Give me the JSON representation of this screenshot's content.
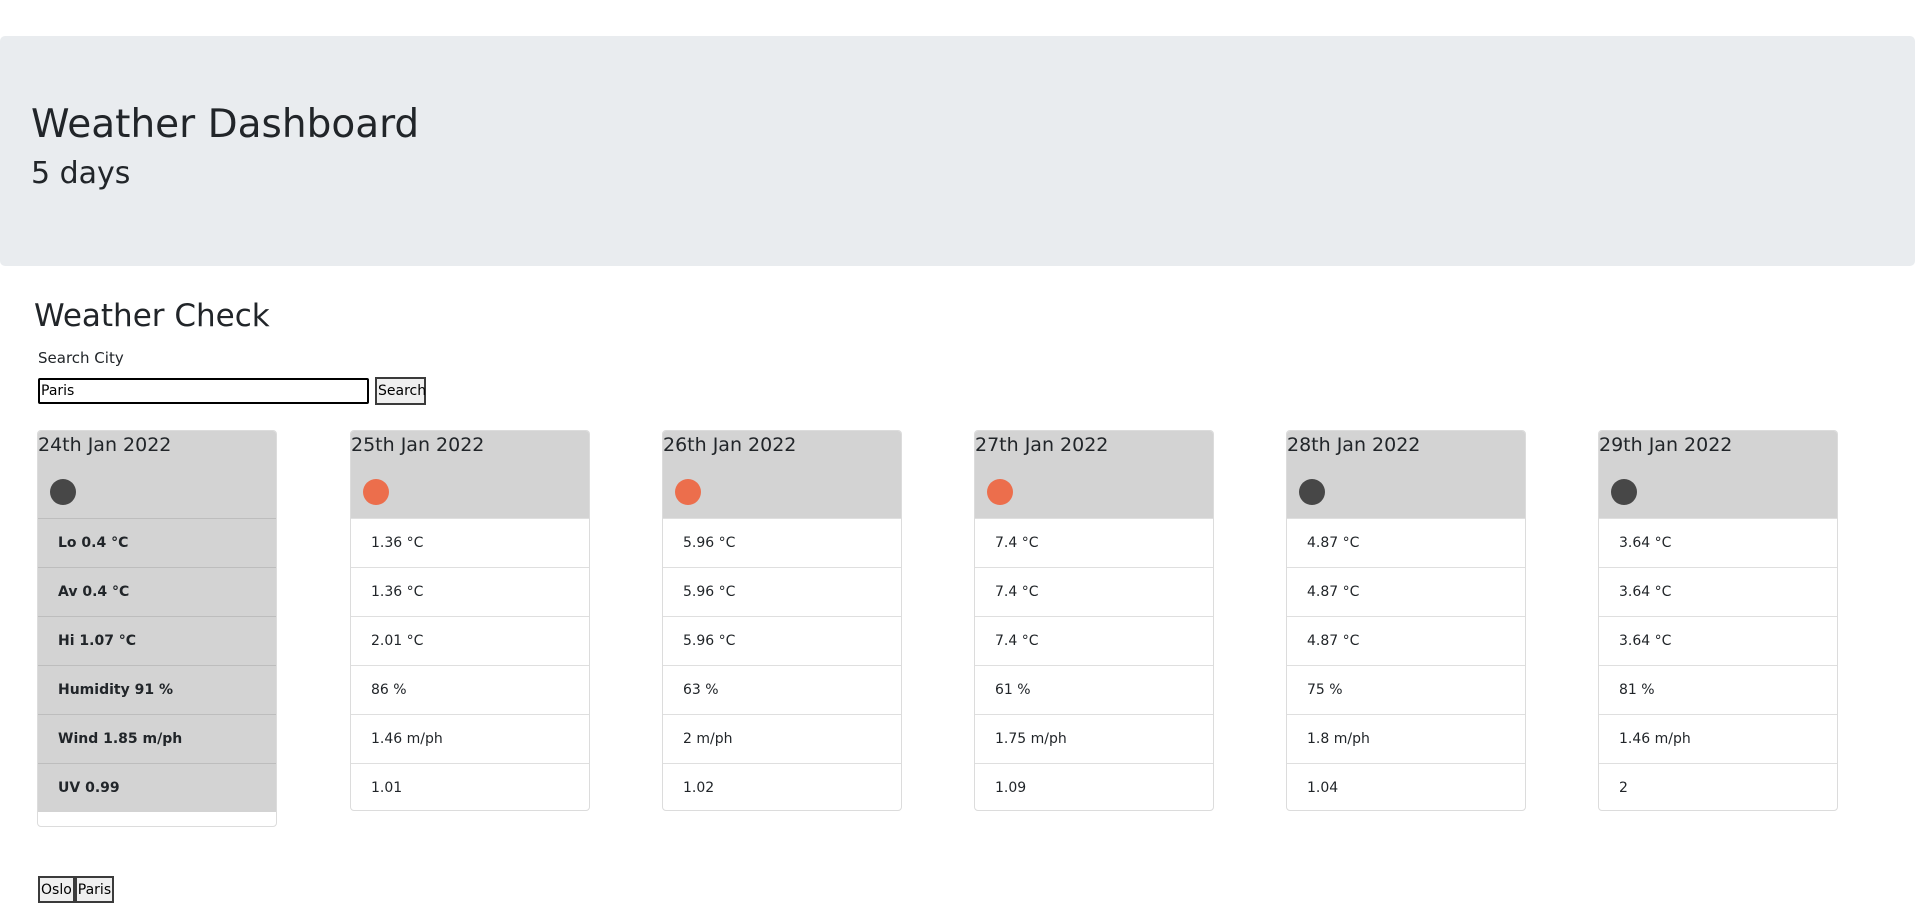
{
  "header": {
    "title": "Weather Dashboard",
    "subtitle": "5 days"
  },
  "search": {
    "heading": "Weather Check",
    "label": "Search City",
    "value": "Paris",
    "button_label": "Search"
  },
  "colors": {
    "dot_dark": "#474747",
    "dot_warm": "#ec6e4c",
    "card_header": "#d3d3d3",
    "banner": "#e9ecef"
  },
  "current": {
    "date": "24th Jan 2022",
    "icon": "dark-dot-icon",
    "lo": "Lo 0.4 °C",
    "av": "Av 0.4 °C",
    "hi": "Hi 1.07 °C",
    "humidity": "Humidity 91 %",
    "wind": "Wind 1.85 m/ph",
    "uv": "UV 0.99"
  },
  "forecast": [
    {
      "date": "25th Jan 2022",
      "icon": "warm-dot-icon",
      "lo": "1.36 °C",
      "av": "1.36 °C",
      "hi": "2.01 °C",
      "humidity": "86 %",
      "wind": "1.46 m/ph",
      "uv": "1.01"
    },
    {
      "date": "26th Jan 2022",
      "icon": "warm-dot-icon",
      "lo": "5.96 °C",
      "av": "5.96 °C",
      "hi": "5.96 °C",
      "humidity": "63 %",
      "wind": "2 m/ph",
      "uv": "1.02"
    },
    {
      "date": "27th Jan 2022",
      "icon": "warm-dot-icon",
      "lo": "7.4 °C",
      "av": "7.4 °C",
      "hi": "7.4 °C",
      "humidity": "61 %",
      "wind": "1.75 m/ph",
      "uv": "1.09"
    },
    {
      "date": "28th Jan 2022",
      "icon": "dark-dot-icon",
      "lo": "4.87 °C",
      "av": "4.87 °C",
      "hi": "4.87 °C",
      "humidity": "75 %",
      "wind": "1.8 m/ph",
      "uv": "1.04"
    },
    {
      "date": "29th Jan 2022",
      "icon": "dark-dot-icon",
      "lo": "3.64 °C",
      "av": "3.64 °C",
      "hi": "3.64 °C",
      "humidity": "81 %",
      "wind": "1.46 m/ph",
      "uv": "2"
    }
  ],
  "history": [
    "Oslo",
    "Paris"
  ]
}
